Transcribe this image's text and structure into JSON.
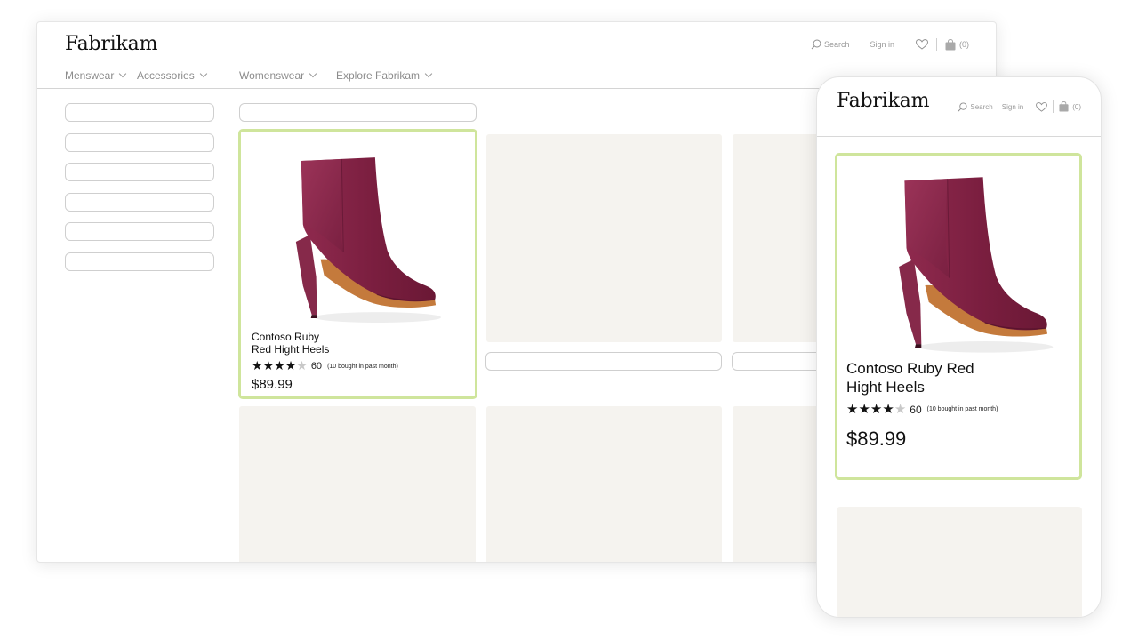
{
  "desktop": {
    "brand": "Fabrikam",
    "utility": {
      "search": "Search",
      "signin": "Sign in",
      "cart_count": "(0)"
    },
    "nav": [
      {
        "label": "Menswear"
      },
      {
        "label": "Accessories"
      },
      {
        "label": "Womenswear"
      },
      {
        "label": "Explore Fabrikam"
      }
    ],
    "product": {
      "name_line1": "Contoso Ruby",
      "name_line2": "Red Hight Heels",
      "rating": 4,
      "rating_max": 5,
      "review_count": "60",
      "bought_note": "(10 bought in past month)",
      "price": "$89.99"
    }
  },
  "mobile": {
    "brand": "Fabrikam",
    "utility": {
      "search": "Search",
      "signin": "Sign in",
      "cart_count": "(0)"
    },
    "product": {
      "name_line1": "Contoso Ruby Red",
      "name_line2": "Hight Heels",
      "rating": 4,
      "rating_max": 5,
      "review_count": "60",
      "bought_note": "(10 bought in past month)",
      "price": "$89.99"
    }
  },
  "colors": {
    "highlight_border": "#cfe59c",
    "placeholder_tile": "#f5f3ef",
    "boot": "#7c1f40"
  },
  "icons": [
    "search-icon",
    "heart-icon",
    "shopping-bag-icon",
    "chevron-down-icon",
    "star-icon"
  ]
}
